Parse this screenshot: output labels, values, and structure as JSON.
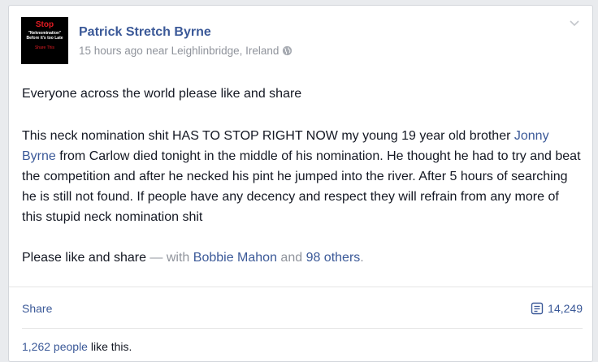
{
  "post": {
    "author": "Patrick Stretch Byrne",
    "avatar": {
      "top": "Stop",
      "middle": "\"Neknomination\" Before it's too Late",
      "bottom": "Share This"
    },
    "time": "15 hours ago",
    "location": "near Leighlinbridge, Ireland",
    "privacy_icon": "globe-icon",
    "menu_icon": "chevron-down-icon",
    "paragraph1": "Everyone across the world please like and share",
    "paragraph2_before": "This neck nomination shit HAS TO STOP RIGHT NOW my young 19 year old brother ",
    "paragraph2_link": "Jonny Byrne",
    "paragraph2_after": " from Carlow died tonight in the middle of his nomination. He thought he had to try and beat the competition and after he necked his pint he jumped into the river. After 5 hours of searching he is still not found. If people have any decency and respect they will refrain from any more of this stupid neck nomination shit",
    "paragraph3_text": "Please like and share",
    "paragraph3_with": " — with ",
    "tagged_person": "Bobbie Mahon",
    "and_text": " and ",
    "others": "98 others",
    "period": "."
  },
  "actions": {
    "share_label": "Share",
    "share_count": "14,249",
    "share_icon": "share-count-icon"
  },
  "likes": {
    "count_text": "1,262 people",
    "suffix": " like this."
  },
  "colors": {
    "link": "#3b5998",
    "muted": "#90949c",
    "text": "#141823"
  }
}
